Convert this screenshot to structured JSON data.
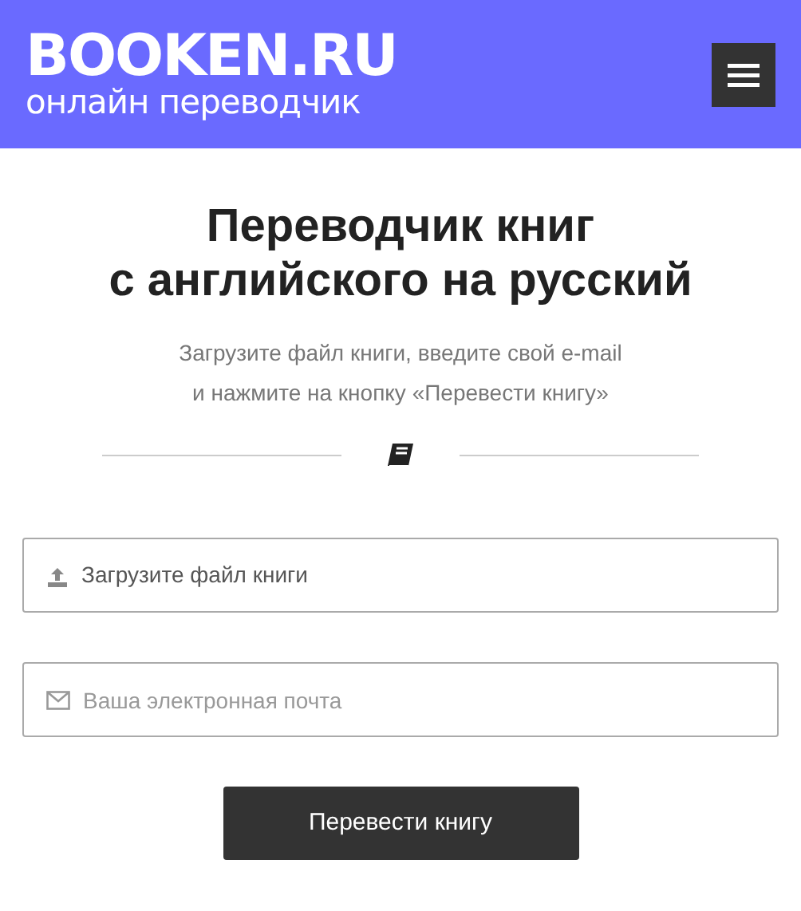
{
  "header": {
    "logo": "BOOKEN.RU",
    "tagline": "онлайн переводчик"
  },
  "heading_lines": [
    "Переводчик книг",
    "с английского на русский"
  ],
  "intro_lines": [
    "Загрузите файл книги, введите свой e-mail",
    "и нажмите на кнопку «Перевести книгу»"
  ],
  "file_field": {
    "label": "Загрузите файл книги"
  },
  "email_field": {
    "placeholder": "Ваша электронная почта"
  },
  "submit_button": "Перевести книгу"
}
